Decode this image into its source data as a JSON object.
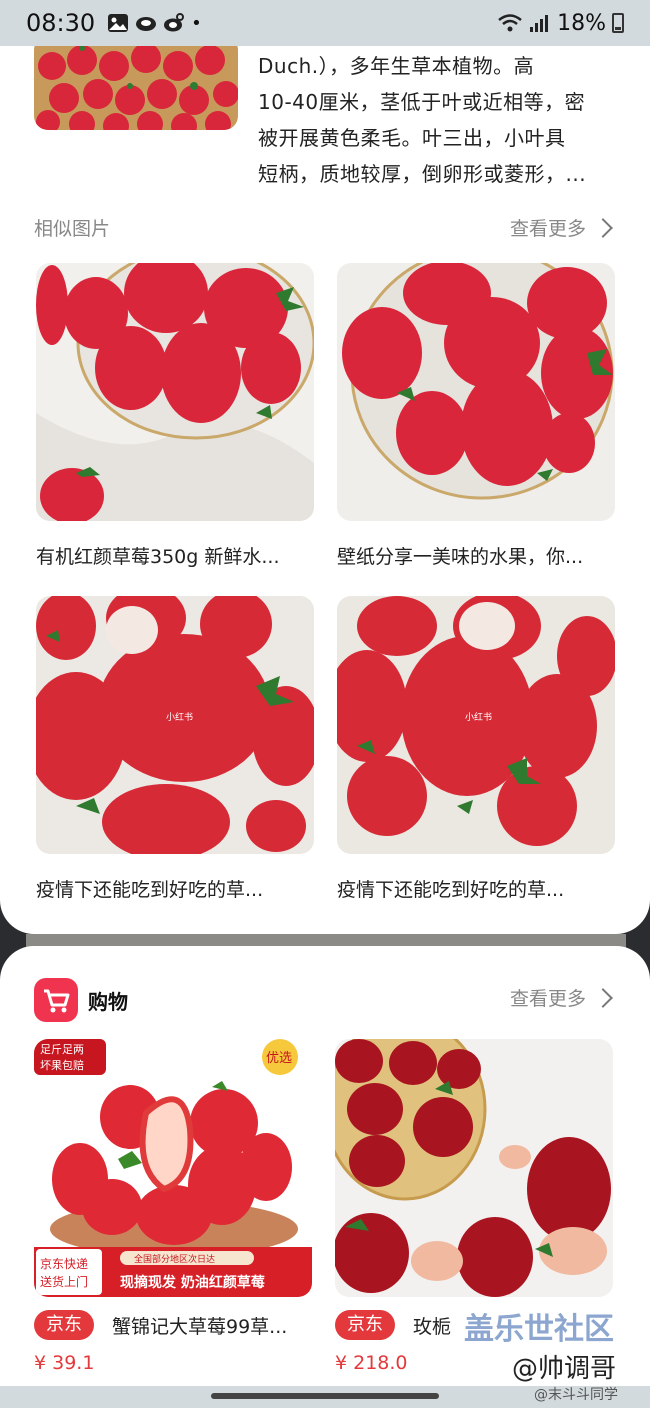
{
  "status": {
    "time": "08:30",
    "battery": "18%",
    "dot": "•"
  },
  "info": {
    "desc_lines": [
      "Duch.），多年生草本植物。高",
      "10-40厘米，茎低于叶或近相等，密",
      "被开展黄色柔毛。叶三出，小叶具",
      "短柄，质地较厚，倒卵形或菱形，..."
    ]
  },
  "similar": {
    "title": "相似图片",
    "more": "查看更多",
    "items": [
      {
        "caption": "有机红颜草莓350g 新鲜水..."
      },
      {
        "caption": "壁纸分享一美味的水果，你..."
      },
      {
        "caption": "疫情下还能吃到好吃的草..."
      },
      {
        "caption": "疫情下还能吃到好吃的草..."
      }
    ],
    "image_marks": [
      "小红书",
      "小红书"
    ]
  },
  "shopping": {
    "title": "购物",
    "more": "查看更多",
    "products": [
      {
        "store": "京东",
        "title": "蟹锦记大草莓99草...",
        "price": "¥ 39.1",
        "tags": {
          "corner": "足斤足两",
          "corner2": "坏果包赔",
          "badge": "优选",
          "banner_top": "全国部分地区次日达",
          "left_label1": "京东快递",
          "left_label2": "送货上门",
          "banner_main": "现摘现发 奶油红颜草莓"
        }
      },
      {
        "store": "京东",
        "title": "玫栀",
        "price": "¥ 218.0"
      }
    ]
  },
  "watermarks": {
    "forum": "盖乐世社区",
    "author": "@帅调哥",
    "weibo": "@末斗斗同学"
  }
}
